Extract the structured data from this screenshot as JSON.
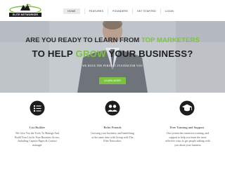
{
  "brand": {
    "logo_text": "ELITE NETWORKER"
  },
  "nav": {
    "items": [
      {
        "label": "HOME"
      },
      {
        "label": "FEATURES"
      },
      {
        "label": "FOUNDERS"
      },
      {
        "label": "GET STARTED"
      },
      {
        "label": "LOGIN"
      }
    ]
  },
  "hero": {
    "line1_prefix": "ARE YOU READY TO LEARN FROM ",
    "line1_accent": "TOP MARKETERS",
    "line2_prefix": "TO HELP ",
    "line2_accent": "GROW",
    "line2_suffix": " YOUR BUSINESS?",
    "tagline": "WE HAVE THE PERFECT SYSTEM FOR YOU",
    "cta_label": "LEARN MORE"
  },
  "features": [
    {
      "icon": "list-icon",
      "title": "List Builder",
      "desc": [
        "We Give You the Tools To Manage And",
        "Build Your List In Your Business Grows,",
        "Including Capture Pages & Contact",
        "manager"
      ]
    },
    {
      "icon": "refer-friends-icon",
      "title": "Refer Friends",
      "desc": [
        "Growing your business, and benefitting",
        "at the same time with Group with The",
        "Elite Networker."
      ]
    },
    {
      "icon": "training-icon",
      "title": "Free Training and Support",
      "desc": [
        "Our system has extensive training, and",
        "support to help you learn the most",
        "effective ways to get people talking with",
        "you about your business"
      ]
    }
  ],
  "colors": {
    "accent": "#7dc242",
    "nav_active_bg": "#e9e9e9"
  }
}
